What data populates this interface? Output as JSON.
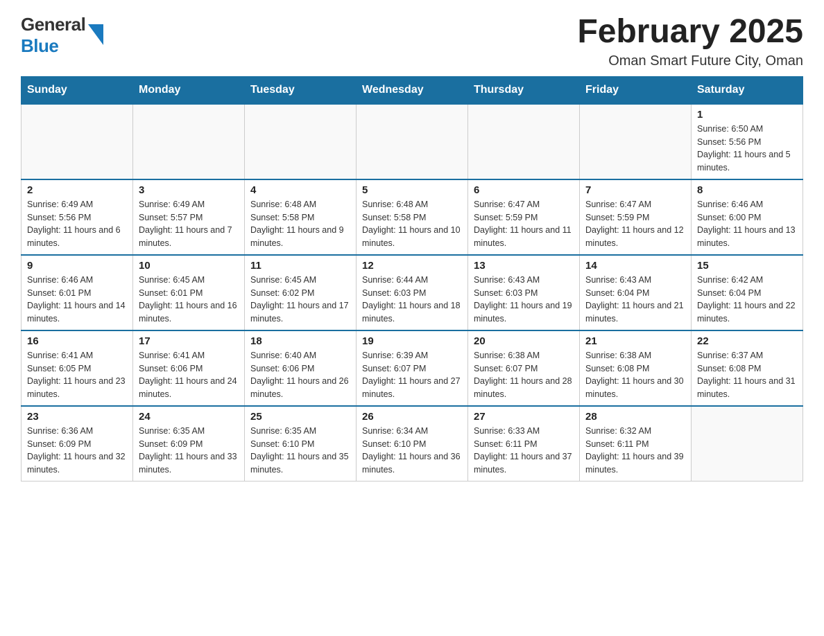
{
  "header": {
    "logo_line1": "General",
    "logo_line2": "Blue",
    "month_year": "February 2025",
    "subtitle": "Oman Smart Future City, Oman"
  },
  "days_of_week": [
    "Sunday",
    "Monday",
    "Tuesday",
    "Wednesday",
    "Thursday",
    "Friday",
    "Saturday"
  ],
  "weeks": [
    [
      {
        "day": "",
        "info": ""
      },
      {
        "day": "",
        "info": ""
      },
      {
        "day": "",
        "info": ""
      },
      {
        "day": "",
        "info": ""
      },
      {
        "day": "",
        "info": ""
      },
      {
        "day": "",
        "info": ""
      },
      {
        "day": "1",
        "info": "Sunrise: 6:50 AM\nSunset: 5:56 PM\nDaylight: 11 hours and 5 minutes."
      }
    ],
    [
      {
        "day": "2",
        "info": "Sunrise: 6:49 AM\nSunset: 5:56 PM\nDaylight: 11 hours and 6 minutes."
      },
      {
        "day": "3",
        "info": "Sunrise: 6:49 AM\nSunset: 5:57 PM\nDaylight: 11 hours and 7 minutes."
      },
      {
        "day": "4",
        "info": "Sunrise: 6:48 AM\nSunset: 5:58 PM\nDaylight: 11 hours and 9 minutes."
      },
      {
        "day": "5",
        "info": "Sunrise: 6:48 AM\nSunset: 5:58 PM\nDaylight: 11 hours and 10 minutes."
      },
      {
        "day": "6",
        "info": "Sunrise: 6:47 AM\nSunset: 5:59 PM\nDaylight: 11 hours and 11 minutes."
      },
      {
        "day": "7",
        "info": "Sunrise: 6:47 AM\nSunset: 5:59 PM\nDaylight: 11 hours and 12 minutes."
      },
      {
        "day": "8",
        "info": "Sunrise: 6:46 AM\nSunset: 6:00 PM\nDaylight: 11 hours and 13 minutes."
      }
    ],
    [
      {
        "day": "9",
        "info": "Sunrise: 6:46 AM\nSunset: 6:01 PM\nDaylight: 11 hours and 14 minutes."
      },
      {
        "day": "10",
        "info": "Sunrise: 6:45 AM\nSunset: 6:01 PM\nDaylight: 11 hours and 16 minutes."
      },
      {
        "day": "11",
        "info": "Sunrise: 6:45 AM\nSunset: 6:02 PM\nDaylight: 11 hours and 17 minutes."
      },
      {
        "day": "12",
        "info": "Sunrise: 6:44 AM\nSunset: 6:03 PM\nDaylight: 11 hours and 18 minutes."
      },
      {
        "day": "13",
        "info": "Sunrise: 6:43 AM\nSunset: 6:03 PM\nDaylight: 11 hours and 19 minutes."
      },
      {
        "day": "14",
        "info": "Sunrise: 6:43 AM\nSunset: 6:04 PM\nDaylight: 11 hours and 21 minutes."
      },
      {
        "day": "15",
        "info": "Sunrise: 6:42 AM\nSunset: 6:04 PM\nDaylight: 11 hours and 22 minutes."
      }
    ],
    [
      {
        "day": "16",
        "info": "Sunrise: 6:41 AM\nSunset: 6:05 PM\nDaylight: 11 hours and 23 minutes."
      },
      {
        "day": "17",
        "info": "Sunrise: 6:41 AM\nSunset: 6:06 PM\nDaylight: 11 hours and 24 minutes."
      },
      {
        "day": "18",
        "info": "Sunrise: 6:40 AM\nSunset: 6:06 PM\nDaylight: 11 hours and 26 minutes."
      },
      {
        "day": "19",
        "info": "Sunrise: 6:39 AM\nSunset: 6:07 PM\nDaylight: 11 hours and 27 minutes."
      },
      {
        "day": "20",
        "info": "Sunrise: 6:38 AM\nSunset: 6:07 PM\nDaylight: 11 hours and 28 minutes."
      },
      {
        "day": "21",
        "info": "Sunrise: 6:38 AM\nSunset: 6:08 PM\nDaylight: 11 hours and 30 minutes."
      },
      {
        "day": "22",
        "info": "Sunrise: 6:37 AM\nSunset: 6:08 PM\nDaylight: 11 hours and 31 minutes."
      }
    ],
    [
      {
        "day": "23",
        "info": "Sunrise: 6:36 AM\nSunset: 6:09 PM\nDaylight: 11 hours and 32 minutes."
      },
      {
        "day": "24",
        "info": "Sunrise: 6:35 AM\nSunset: 6:09 PM\nDaylight: 11 hours and 33 minutes."
      },
      {
        "day": "25",
        "info": "Sunrise: 6:35 AM\nSunset: 6:10 PM\nDaylight: 11 hours and 35 minutes."
      },
      {
        "day": "26",
        "info": "Sunrise: 6:34 AM\nSunset: 6:10 PM\nDaylight: 11 hours and 36 minutes."
      },
      {
        "day": "27",
        "info": "Sunrise: 6:33 AM\nSunset: 6:11 PM\nDaylight: 11 hours and 37 minutes."
      },
      {
        "day": "28",
        "info": "Sunrise: 6:32 AM\nSunset: 6:11 PM\nDaylight: 11 hours and 39 minutes."
      },
      {
        "day": "",
        "info": ""
      }
    ]
  ]
}
